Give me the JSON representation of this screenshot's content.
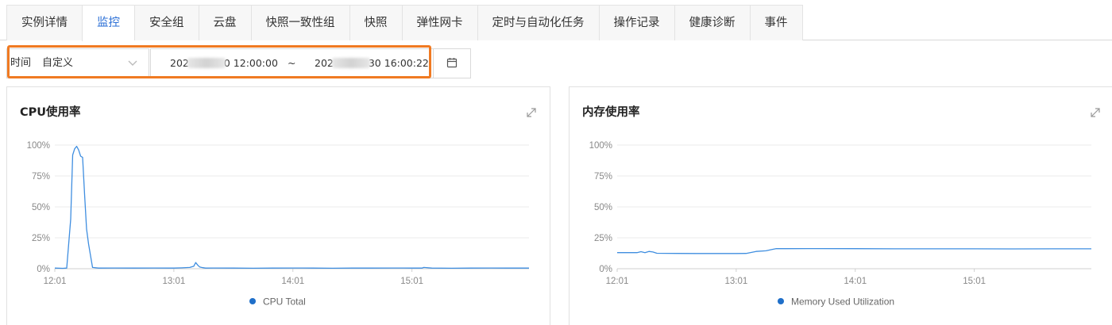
{
  "tabs": [
    {
      "label": "实例详情",
      "active": false
    },
    {
      "label": "监控",
      "active": true
    },
    {
      "label": "安全组",
      "active": false
    },
    {
      "label": "云盘",
      "active": false
    },
    {
      "label": "快照一致性组",
      "active": false
    },
    {
      "label": "快照",
      "active": false
    },
    {
      "label": "弹性网卡",
      "active": false
    },
    {
      "label": "定时与自动化任务",
      "active": false
    },
    {
      "label": "操作记录",
      "active": false
    },
    {
      "label": "健康诊断",
      "active": false
    },
    {
      "label": "事件",
      "active": false
    }
  ],
  "time_filter": {
    "label": "时间",
    "mode": "自定义",
    "start_prefix": "202",
    "start_suffix": "0 12:00:00",
    "separator": "~",
    "end_prefix": "202",
    "end_suffix": "30 16:00:22",
    "icons": {
      "dropdown": "chevron-down-icon",
      "calendar": "calendar-icon"
    }
  },
  "colors": {
    "accent": "#2b6fd6",
    "highlight": "#f07a22",
    "line": "#3f8ee0",
    "legend_dot": "#1f6fc9"
  },
  "charts": [
    {
      "title": "CPU使用率",
      "chart_data": {
        "type": "line",
        "title": "CPU使用率",
        "xlabel": "",
        "ylabel": "",
        "x_ticks": [
          "12:01",
          "13:01",
          "14:01",
          "15:01"
        ],
        "xlim": [
          0,
          239
        ],
        "ylim": [
          0,
          100
        ],
        "y_ticks": [
          "0%",
          "25%",
          "50%",
          "75%",
          "100%"
        ],
        "grid": true,
        "legend": "bottom",
        "series": [
          {
            "name": "CPU Total",
            "x": [
              0,
              4,
              6,
              8,
              9,
              10,
              11,
              12,
              13,
              14,
              15,
              16,
              17,
              19,
              22,
              30,
              40,
              50,
              60,
              64,
              68,
              70,
              71,
              72,
              73,
              74,
              76,
              80,
              90,
              100,
              110,
              120,
              130,
              140,
              150,
              160,
              170,
              180,
              185,
              186,
              190,
              200,
              210,
              220,
              230,
              239
            ],
            "y": [
              0.5,
              0.3,
              0.5,
              40,
              92,
              97,
              99,
              96,
              91,
              90,
              60,
              32,
              20,
              1,
              0.5,
              0.6,
              0.5,
              0.6,
              0.5,
              0.7,
              1,
              2,
              5,
              3,
              1.5,
              1,
              0.5,
              0.6,
              0.5,
              0.4,
              0.5,
              0.6,
              0.5,
              0.4,
              0.5,
              0.5,
              0.6,
              0.5,
              0.5,
              1,
              0.5,
              0.4,
              0.5,
              0.6,
              0.5,
              0.5
            ]
          }
        ]
      }
    },
    {
      "title": "内存使用率",
      "chart_data": {
        "type": "line",
        "title": "内存使用率",
        "xlabel": "",
        "ylabel": "",
        "x_ticks": [
          "12:01",
          "13:01",
          "14:01",
          "15:01"
        ],
        "xlim": [
          0,
          239
        ],
        "ylim": [
          0,
          100
        ],
        "y_ticks": [
          "0%",
          "25%",
          "50%",
          "75%",
          "100%"
        ],
        "grid": true,
        "legend": "bottom",
        "series": [
          {
            "name": "Memory Used Utilization",
            "x": [
              0,
              10,
              12,
              14,
              16,
              18,
              20,
              30,
              40,
              50,
              60,
              65,
              70,
              75,
              78,
              80,
              85,
              100,
              120,
              140,
              160,
              180,
              200,
              220,
              239
            ],
            "y": [
              13,
              13,
              13.8,
              13,
              14,
              13.5,
              12.5,
              12.4,
              12.3,
              12.3,
              12.3,
              12.4,
              14,
              14.5,
              15.5,
              16.2,
              16.2,
              16.3,
              16.2,
              16.1,
              16.1,
              16.1,
              16,
              16.1,
              16.1
            ]
          }
        ]
      }
    }
  ]
}
